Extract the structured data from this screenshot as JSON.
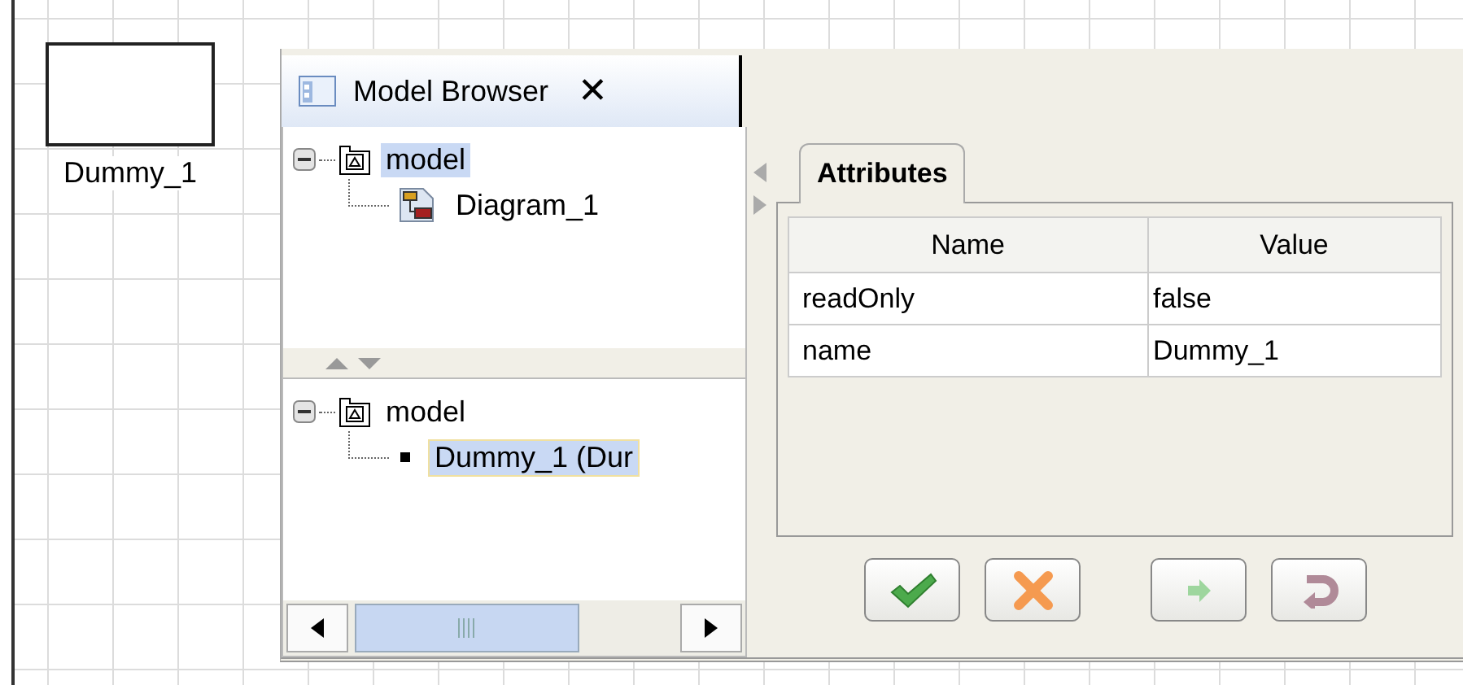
{
  "canvas": {
    "nodes": [
      {
        "label": "Dummy_1"
      }
    ]
  },
  "model_browser": {
    "tab": {
      "title": "Model Browser",
      "close": "✕",
      "selected": true
    },
    "top_tree": [
      {
        "label": "model",
        "kind": "package",
        "expanded": true,
        "selected": true,
        "children": [
          {
            "label": "Diagram_1",
            "kind": "diagram",
            "selected": false
          }
        ]
      }
    ],
    "bottom_tree": [
      {
        "label": "model",
        "kind": "package",
        "expanded": true,
        "selected": false,
        "children": [
          {
            "label": "Dummy_1 (Dur",
            "kind": "element",
            "selected": true
          }
        ]
      }
    ],
    "attributes": {
      "tab": {
        "label": "Attributes",
        "selected": true
      },
      "columns": [
        "Name",
        "Value"
      ],
      "rows": [
        [
          "readOnly",
          "false"
        ],
        [
          "name",
          "Dummy_1"
        ]
      ]
    },
    "buttons": [
      {
        "kind": "apply"
      },
      {
        "kind": "cancel"
      },
      {
        "kind": "next"
      },
      {
        "kind": "undo"
      }
    ]
  }
}
